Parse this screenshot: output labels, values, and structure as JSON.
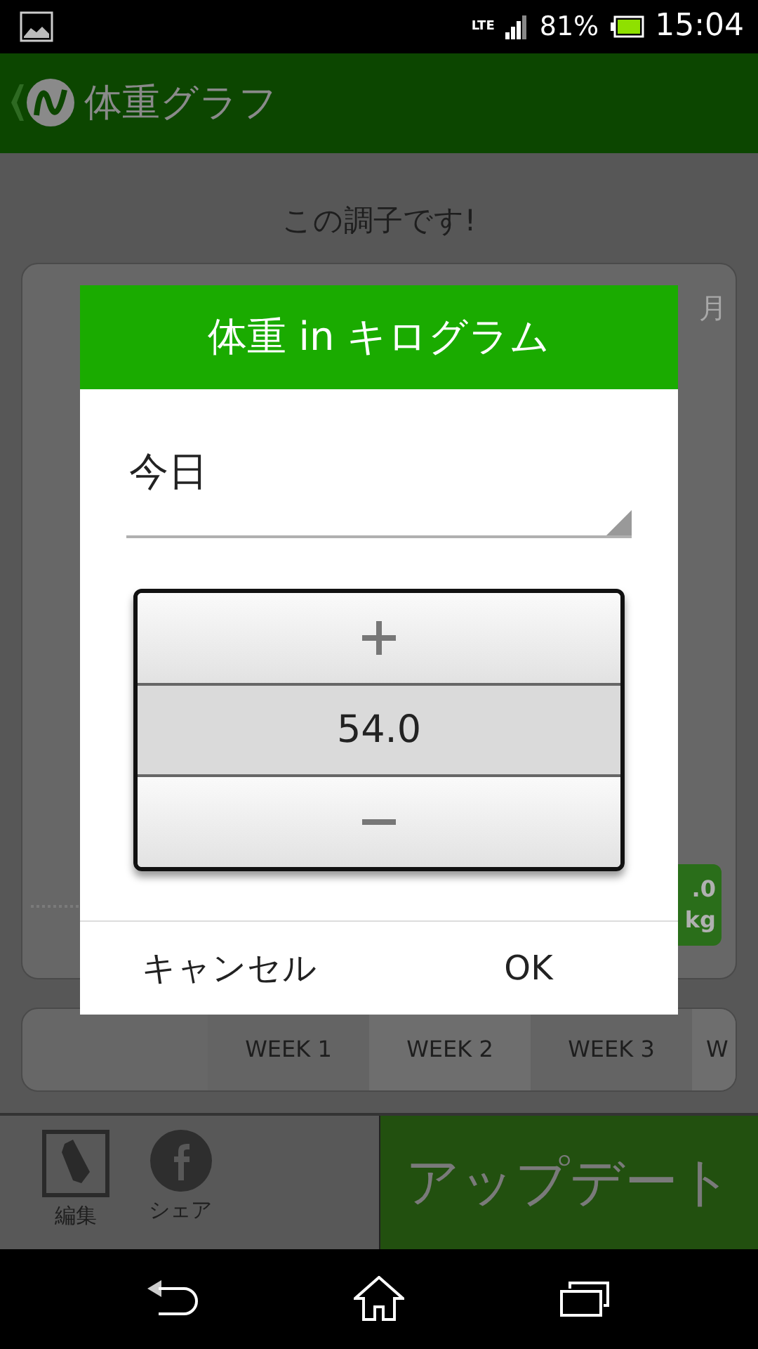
{
  "status_bar": {
    "network": "LTE",
    "battery": "81%",
    "time": "15:04"
  },
  "header": {
    "title": "体重グラフ"
  },
  "message": "この調子です!",
  "chart_card": {
    "month_label": "月",
    "badge_value": ".0",
    "badge_unit": "kg"
  },
  "weeks": [
    {
      "label": "WEEK 1"
    },
    {
      "label": "WEEK 2"
    },
    {
      "label": "WEEK 3"
    },
    {
      "label": "W"
    }
  ],
  "toolbar": {
    "edit": "編集",
    "share": "シェア",
    "update": "アップデート"
  },
  "dialog": {
    "title": "体重 in キログラム",
    "date_field": "今日",
    "value": "54.0",
    "buttons": [
      {
        "label": "キャンセル"
      },
      {
        "label": "OK"
      }
    ]
  }
}
